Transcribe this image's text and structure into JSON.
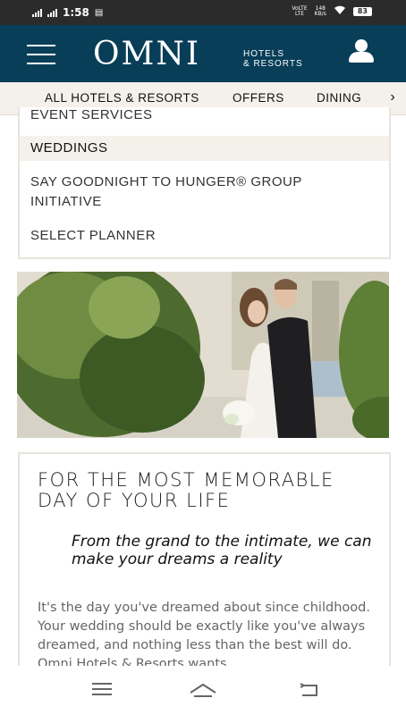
{
  "status_bar": {
    "time": "1:58",
    "volte": "VoLTE",
    "lte": "LTE",
    "speed": "148",
    "speed_unit": "KB/s",
    "battery": "83"
  },
  "header": {
    "logo_main": "OMNI",
    "logo_sub_1": "HOTELS",
    "logo_sub_2": "& RESORTS"
  },
  "nav": {
    "items": [
      {
        "label": "ALL HOTELS & RESORTS"
      },
      {
        "label": "OFFERS"
      },
      {
        "label": "DINING"
      }
    ]
  },
  "submenu": {
    "items": [
      {
        "label": "EVENT SERVICES"
      },
      {
        "label": "WEDDINGS"
      },
      {
        "label": "SAY GOODNIGHT TO HUNGER® GROUP"
      },
      {
        "label": "INITIATIVE"
      },
      {
        "label": "SELECT PLANNER"
      }
    ]
  },
  "feature": {
    "title": "FOR THE MOST MEMORABLE DAY OF YOUR LIFE",
    "subtitle": "From the grand to the intimate, we can make your dreams a reality",
    "body": "It's the day you've dreamed about since childhood. Your wedding should be exactly like you've always dreamed, and nothing less than the best will do. Omni Hotels & Resorts wants"
  },
  "colors": {
    "header_bg": "#083e58",
    "nav_bg": "#f4f1ea",
    "accent_text": "#222222"
  }
}
